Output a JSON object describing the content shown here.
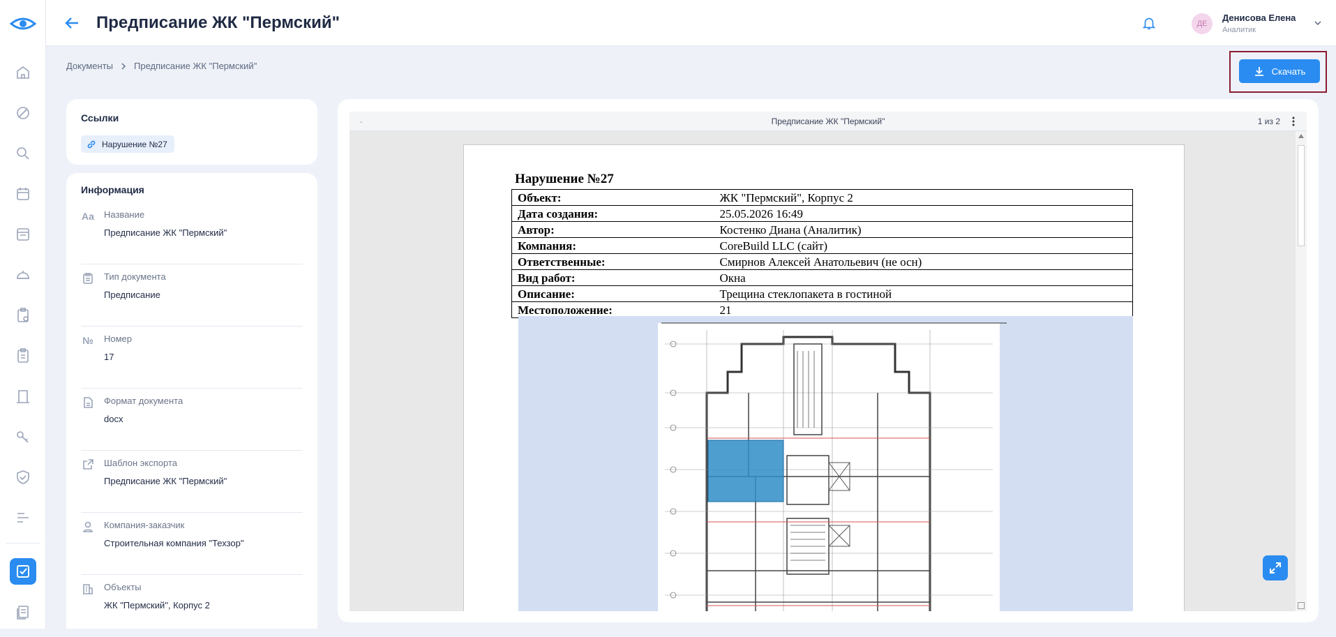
{
  "header": {
    "title": "Предписание ЖК \"Пермский\"",
    "user": {
      "initials": "ДЕ",
      "name": "Денисова Елена",
      "role": "Аналитик"
    }
  },
  "breadcrumb": {
    "root": "Документы",
    "current": "Предписание ЖК \"Пермский\""
  },
  "actions": {
    "download_label": "Скачать"
  },
  "links": {
    "title": "Ссылки",
    "items": [
      {
        "label": "Нарушение №27"
      }
    ]
  },
  "info": {
    "title": "Информация",
    "fields": [
      {
        "icon": "text-aa-icon",
        "label": "Название",
        "value": "Предписание ЖК \"Пермский\""
      },
      {
        "icon": "clipboard-icon",
        "label": "Тип документа",
        "value": "Предписание"
      },
      {
        "icon": "number-sign-icon",
        "label": "Номер",
        "value": "17"
      },
      {
        "icon": "file-icon",
        "label": "Формат документа",
        "value": "docx"
      },
      {
        "icon": "export-icon",
        "label": "Шаблон экспорта",
        "value": "Предписание ЖК \"Пермский\""
      },
      {
        "icon": "user-icon",
        "label": "Компания-заказчик",
        "value": "Строительная компания \"Техзор\""
      },
      {
        "icon": "building-icon",
        "label": "Объекты",
        "value": "ЖК \"Пермский\", Корпус 2"
      }
    ]
  },
  "viewer": {
    "doc_name": "Предписание ЖК \"Пермский\"",
    "page_indicator": "1 из 2",
    "toolbar_mark": "-",
    "document": {
      "heading": "Нарушение №27",
      "rows": [
        {
          "key": "Объект:",
          "value": "ЖК \"Пермский\", Корпус 2"
        },
        {
          "key": "Дата создания:",
          "value": "25.05.2026 16:49"
        },
        {
          "key": "Автор:",
          "value": "Костенко Диана (Аналитик)"
        },
        {
          "key": "Компания:",
          "value": "CoreBuild LLC (сайт)"
        },
        {
          "key": "Ответственные:",
          "value": "Смирнов Алексей Анатольевич (не осн)"
        },
        {
          "key": "Вид работ:",
          "value": "Окна"
        },
        {
          "key": "Описание:",
          "value": "Трещина стеклопакета в гостиной"
        },
        {
          "key": "Местоположение:",
          "value": "21"
        }
      ]
    }
  },
  "sidebar": {
    "items": [
      {
        "icon": "home-icon"
      },
      {
        "icon": "block-icon"
      },
      {
        "icon": "search-icon"
      },
      {
        "icon": "calendar-icon"
      },
      {
        "icon": "folder-icon"
      },
      {
        "icon": "helmet-icon"
      },
      {
        "icon": "checklist-icon"
      },
      {
        "icon": "clipboard-icon"
      },
      {
        "icon": "door-icon"
      },
      {
        "icon": "key-icon"
      },
      {
        "icon": "shield-icon"
      },
      {
        "icon": "gantt-icon"
      },
      {
        "icon": "checkbox-icon",
        "active": true
      },
      {
        "icon": "documents-icon"
      }
    ]
  },
  "colors": {
    "accent": "#2a8cf0",
    "highlight_frame": "#8a1c30",
    "background": "#eef2f8"
  }
}
